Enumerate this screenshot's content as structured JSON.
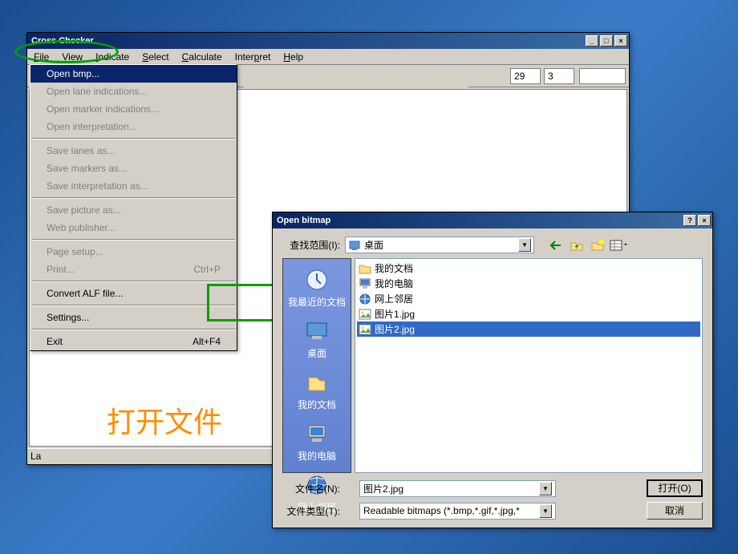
{
  "main": {
    "title": "Cross Checker",
    "menus": [
      "File",
      "View",
      "Indicate",
      "Select",
      "Calculate",
      "Interpret",
      "Help"
    ],
    "toolbar": {
      "field1": "29",
      "field2": "3"
    },
    "status": "La"
  },
  "dropdown": {
    "items": [
      {
        "label": "Open bmp...",
        "enabled": true
      },
      {
        "label": "Open lane indications...",
        "enabled": false
      },
      {
        "label": "Open marker indications...",
        "enabled": false
      },
      {
        "label": "Open interpretation...",
        "enabled": false
      },
      {
        "sep": true
      },
      {
        "label": "Save lanes as...",
        "enabled": false
      },
      {
        "label": "Save markers as...",
        "enabled": false
      },
      {
        "label": "Save interpretation as...",
        "enabled": false
      },
      {
        "sep": true
      },
      {
        "label": "Save picture as...",
        "enabled": false
      },
      {
        "label": "Web publisher...",
        "enabled": false
      },
      {
        "sep": true
      },
      {
        "label": "Page setup...",
        "enabled": false
      },
      {
        "label": "Print...",
        "enabled": false,
        "shortcut": "Ctrl+P"
      },
      {
        "sep": true
      },
      {
        "label": "Convert ALF file...",
        "enabled": true
      },
      {
        "sep": true
      },
      {
        "label": "Settings...",
        "enabled": true
      },
      {
        "sep": true
      },
      {
        "label": "Exit",
        "enabled": true,
        "shortcut": "Alt+F4"
      }
    ]
  },
  "dialog": {
    "title": "Open bitmap",
    "lookin_label": "查找范围(I):",
    "lookin_value": "桌面",
    "places": [
      "我最近的文档",
      "桌面",
      "我的文档",
      "我的电脑",
      "网上邻居"
    ],
    "files": [
      {
        "name": "我的文档",
        "type": "folder"
      },
      {
        "name": "我的电脑",
        "type": "computer"
      },
      {
        "name": "网上邻居",
        "type": "network"
      },
      {
        "name": "图片1.jpg",
        "type": "image"
      },
      {
        "name": "图片2.jpg",
        "type": "image",
        "selected": true
      }
    ],
    "filename_label": "文件名(N):",
    "filename_value": "图片2.jpg",
    "filetype_label": "文件类型(T):",
    "filetype_value": "Readable bitmaps (*.bmp,*.gif,*.jpg,*",
    "open_btn": "打开(O)",
    "cancel_btn": "取消"
  },
  "annotation": "打开文件"
}
